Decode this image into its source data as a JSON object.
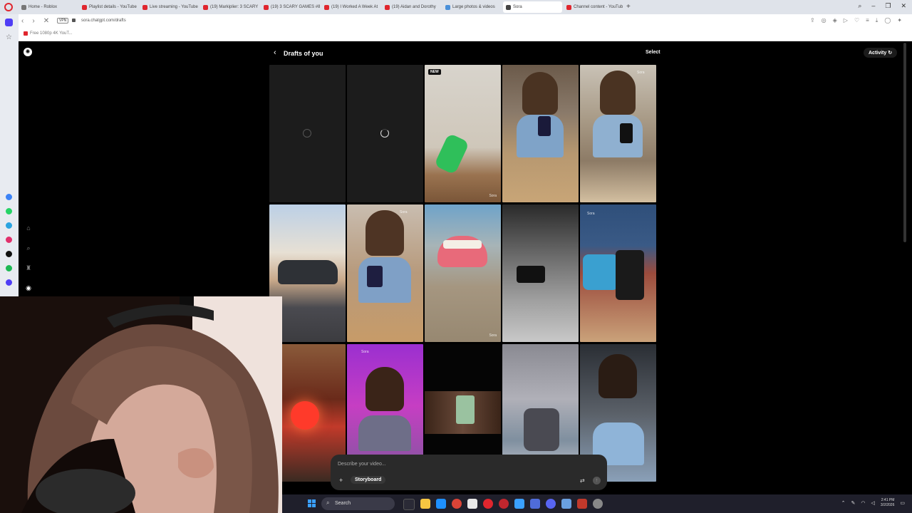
{
  "browser": {
    "tabs": [
      {
        "title": "Home - Roblox",
        "fav": "#777"
      },
      {
        "title": "Playlist details - YouTube",
        "fav": "#e0262e"
      },
      {
        "title": "Live streaming - YouTube",
        "fav": "#e0262e"
      },
      {
        "title": "(19) Markiplier: 3 SCARY",
        "fav": "#e0262e"
      },
      {
        "title": "(19) 3 SCARY GAMES #84",
        "fav": "#e0262e"
      },
      {
        "title": "(19) I Worked A Week At",
        "fav": "#e0262e"
      },
      {
        "title": "(19) Aidan and Dorothy",
        "fav": "#e0262e"
      },
      {
        "title": "Large photos & videos",
        "fav": "#4a90d9"
      },
      {
        "title": "Sora",
        "fav": "#444",
        "active": true
      },
      {
        "title": "Channel content - YouTube",
        "fav": "#e0262e"
      }
    ],
    "url": "sora.chatgpt.com/drafts",
    "vpn_label": "VPN",
    "bookmark": "Free 1080p 4K YouT..."
  },
  "sora": {
    "title": "Drafts of you",
    "select_label": "Select",
    "activity_label": "Activity",
    "new_badge": "NEW",
    "watermark": "Sora",
    "composer": {
      "placeholder": "Describe your video...",
      "storyboard_label": "Storyboard"
    }
  },
  "taskbar": {
    "search_label": "Search",
    "time": "2:41 PM",
    "date": "3/2/2026"
  },
  "colors": {
    "accent": "#4f3df5",
    "opera_red": "#e0262e",
    "background": "#000000"
  }
}
